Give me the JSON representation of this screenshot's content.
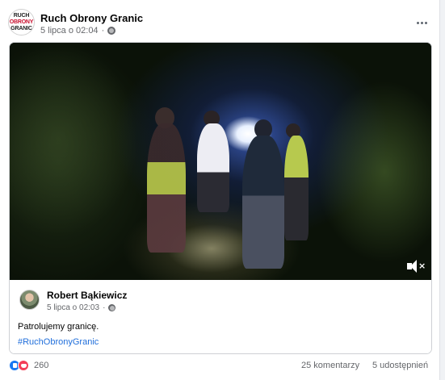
{
  "post": {
    "page_avatar": {
      "line1": "RUCH",
      "line2": "OBRONY",
      "line3": "GRANIC"
    },
    "page_name": "Ruch Obrony Granic",
    "timestamp": "5 lipca o 02:04",
    "privacy_icon": "globe-icon",
    "more_icon": "more-options-icon"
  },
  "shared_post": {
    "video": {
      "description_icon": "muted-speaker-icon"
    },
    "author_name": "Robert Bąkiewicz",
    "timestamp": "5 lipca o 02:03",
    "privacy_icon": "globe-icon",
    "text": "Patrolujemy granicę.",
    "hashtag": "#RuchObronyGranic"
  },
  "footer": {
    "reaction_icons": [
      "like-icon",
      "love-icon"
    ],
    "reaction_count": "260",
    "comments": "25 komentarzy",
    "shares": "5 udostępnień"
  },
  "colors": {
    "link": "#216fdb",
    "meta_text": "#65676b",
    "like": "#1877f2",
    "love": "#f33e58"
  }
}
